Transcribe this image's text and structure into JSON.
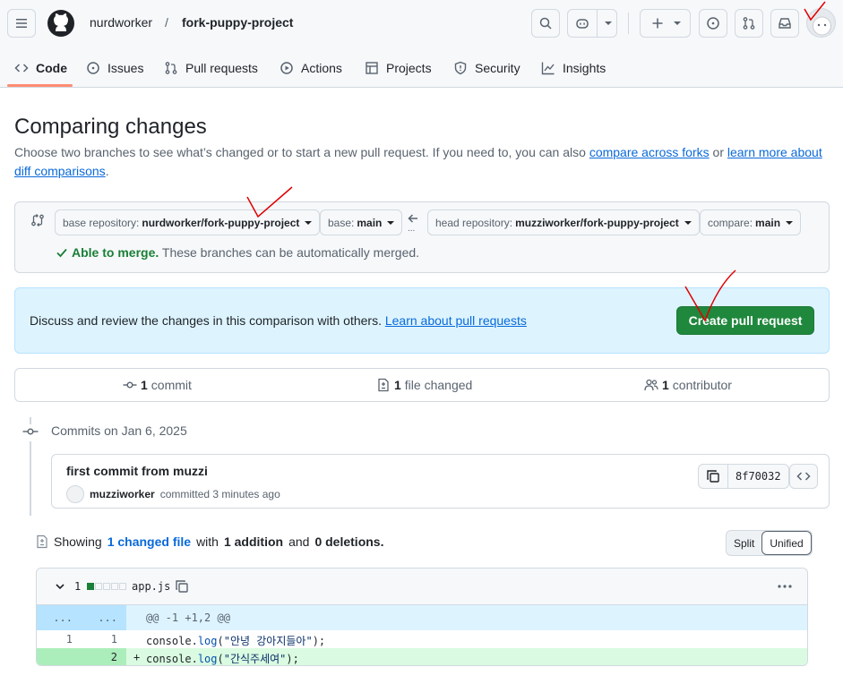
{
  "header": {
    "owner": "nurdworker",
    "separator": "/",
    "repo": "fork-puppy-project"
  },
  "tabs": [
    {
      "label": "Code",
      "icon": "code-icon"
    },
    {
      "label": "Issues",
      "icon": "issue-opened-icon"
    },
    {
      "label": "Pull requests",
      "icon": "git-pull-request-icon"
    },
    {
      "label": "Actions",
      "icon": "play-icon"
    },
    {
      "label": "Projects",
      "icon": "table-icon"
    },
    {
      "label": "Security",
      "icon": "shield-icon"
    },
    {
      "label": "Insights",
      "icon": "graph-icon"
    }
  ],
  "page": {
    "title": "Comparing changes",
    "desc_before": "Choose two branches to see what’s changed or to start a new pull request. If you need to, you can also ",
    "link_forks": "compare across forks",
    "desc_or": " or ",
    "link_learn": "learn more about diff comparisons",
    "desc_end": "."
  },
  "range": {
    "base_repo_label": "base repository:",
    "base_repo_value": "nurdworker/fork-puppy-project",
    "base_label": "base:",
    "base_value": "main",
    "head_repo_label": "head repository:",
    "head_repo_value": "muzziworker/fork-puppy-project",
    "compare_label": "compare:",
    "compare_value": "main",
    "arrow_dots": "...",
    "merge_status": "Able to merge.",
    "merge_note": " These branches can be automatically merged."
  },
  "blankslate": {
    "text": "Discuss and review the changes in this comparison with others. ",
    "link": "Learn about pull requests",
    "button": "Create pull request"
  },
  "stats": {
    "commits_count": "1",
    "commits_label": "commit",
    "files_count": "1",
    "files_label": "file changed",
    "contributors_count": "1",
    "contributors_label": "contributor"
  },
  "commits": {
    "group_title": "Commits on Jan 6, 2025",
    "message": "first commit from muzzi",
    "author": "muzziworker",
    "action": "committed",
    "when": "3 minutes ago",
    "sha": "8f70032"
  },
  "summary": {
    "prefix": "Showing",
    "changed": "1 changed file",
    "with": "with",
    "additions": "1 addition",
    "and": "and",
    "deletions": "0 deletions",
    "end": "."
  },
  "view_toggle": {
    "split": "Split",
    "unified": "Unified"
  },
  "diff": {
    "changes": "1",
    "filename": "app.js",
    "hunk_dots_left": "...",
    "hunk_dots_right": "...",
    "hunk_header": "@@ -1 +1,2 @@",
    "lines": [
      {
        "old": "1",
        "new": "1",
        "sign": "",
        "obj": "console",
        "dot": ".",
        "fn": "log",
        "open": "(",
        "str": "\"안녕 강아지들아\"",
        "close": ");"
      },
      {
        "old": "",
        "new": "2",
        "sign": "+",
        "obj": "console",
        "dot": ".",
        "fn": "log",
        "open": "(",
        "str": "\"간식주세여\"",
        "close": ");"
      }
    ]
  },
  "colors": {
    "primary_button": "#1f883d",
    "link": "#0969da",
    "success": "#1a7f37",
    "annotation": "#e00000"
  }
}
